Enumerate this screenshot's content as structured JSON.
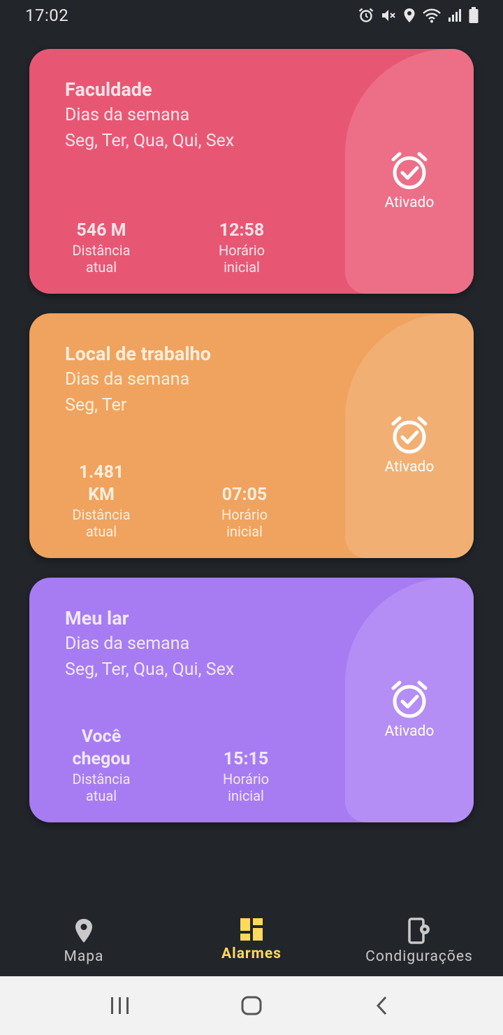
{
  "status_bar": {
    "time": "17:02",
    "icons": [
      "alarm-icon",
      "mute-icon",
      "location-icon",
      "wifi-icon",
      "signal-icon",
      "battery-icon"
    ]
  },
  "alarms": [
    {
      "title": "Faculdade",
      "days_label": "Dias da semana",
      "days": "Seg, Ter, Qua, Qui, Sex",
      "distance_value": "546 M",
      "distance_label_line1": "Distância",
      "distance_label_line2": "atual",
      "time_value": "12:58",
      "time_label_line1": "Horário",
      "time_label_line2": "inicial",
      "status": "Ativado",
      "color": "#e75774",
      "accent": "#ec6f87",
      "text_color": "#fde4e9"
    },
    {
      "title": "Local de trabalho",
      "days_label": "Dias da semana",
      "days": "Seg, Ter",
      "distance_value": "1.481\nKM",
      "distance_label_line1": "Distância",
      "distance_label_line2": "atual",
      "time_value": "07:05",
      "time_label_line1": "Horário",
      "time_label_line2": "inicial",
      "status": "Ativado",
      "color": "#f0a35e",
      "accent": "#f2af74",
      "text_color": "#fdeedd"
    },
    {
      "title": "Meu lar",
      "days_label": "Dias da semana",
      "days": "Seg, Ter, Qua, Qui, Sex",
      "distance_value": "Você\nchegou",
      "distance_label_line1": "Distância",
      "distance_label_line2": "atual",
      "time_value": "15:15",
      "time_label_line1": "Horário",
      "time_label_line2": "inicial",
      "status": "Ativado",
      "color": "#a77cf2",
      "accent": "#b48ef5",
      "text_color": "#f0e8fe"
    }
  ],
  "bottom_nav": {
    "items": [
      {
        "label": "Mapa",
        "icon": "map-pin-icon",
        "active": false
      },
      {
        "label": "Alarmes",
        "icon": "dashboard-icon",
        "active": true
      },
      {
        "label": "Condigurações",
        "icon": "phone-settings-icon",
        "active": false
      }
    ],
    "active_color": "#ffd95e",
    "inactive_color": "#c9c9c9"
  },
  "system_nav": {
    "icons": [
      "recent-apps-icon",
      "home-icon",
      "back-icon"
    ]
  }
}
